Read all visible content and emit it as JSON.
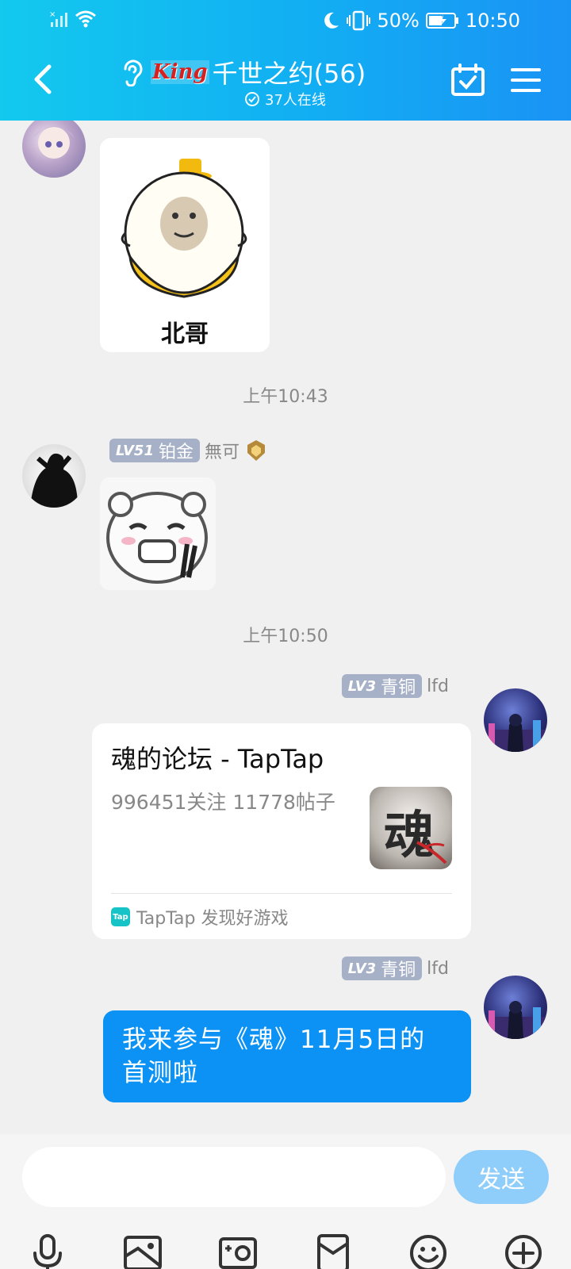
{
  "status": {
    "battery": "50%",
    "time": "10:50"
  },
  "header": {
    "brand": "King",
    "title": "千世之约(56)",
    "online": "37人在线"
  },
  "messages": [
    {
      "type": "sticker",
      "caption": "北哥"
    },
    {
      "type": "timestamp",
      "text": "上午10:43"
    },
    {
      "type": "sticker",
      "level": "LV51",
      "rank": "铂金",
      "nickname": "無可"
    },
    {
      "type": "timestamp",
      "text": "上午10:50"
    },
    {
      "type": "share",
      "level": "LV3",
      "rank": "青铜",
      "nickname": "lfd",
      "title": "魂的论坛 - TapTap",
      "subtitle": "996451关注 11778帖子",
      "thumb_glyph": "魂",
      "source_logo": "Tap",
      "source": "TapTap 发现好游戏"
    },
    {
      "type": "text",
      "level": "LV3",
      "rank": "青铜",
      "nickname": "lfd",
      "line1": "我来参与《魂》11月5日的",
      "line2": "首测啦"
    }
  ],
  "input": {
    "placeholder": "",
    "send_label": "发送"
  },
  "toolbar": [
    "mic-icon",
    "image-icon",
    "camera-icon",
    "red-packet-icon",
    "emoji-icon",
    "plus-icon"
  ],
  "colors": {
    "header_start": "#13c9ee",
    "header_end": "#1a93f5",
    "bubble": "#0b92f4",
    "send": "#8fcdfa",
    "badge": "#a6b0c6"
  }
}
